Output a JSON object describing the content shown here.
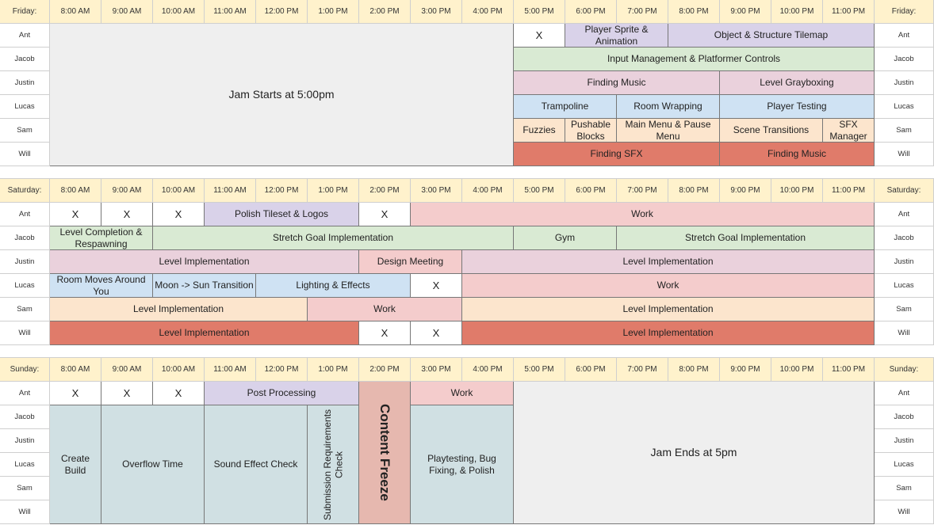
{
  "colors": {
    "header": "#fff2cc",
    "grey": "#efefef",
    "purple": "#d9d2e9",
    "green": "#d9ead3",
    "pink": "#ead1dc",
    "blue": "#cfe2f3",
    "peach": "#fce5cd",
    "red": "#e07b6a",
    "salmon": "#f4cccc",
    "teal": "#d0e0e3",
    "freeze": "#e6b8af",
    "white": "#ffffff"
  },
  "hours": [
    "8:00 AM",
    "9:00 AM",
    "10:00 AM",
    "11:00 AM",
    "12:00 PM",
    "1:00 PM",
    "2:00 PM",
    "3:00 PM",
    "4:00 PM",
    "5:00 PM",
    "6:00 PM",
    "7:00 PM",
    "8:00 PM",
    "9:00 PM",
    "10:00 PM",
    "11:00 PM"
  ],
  "people": [
    "Ant",
    "Jacob",
    "Justin",
    "Lucas",
    "Sam",
    "Will"
  ],
  "days": [
    {
      "label": "Friday:",
      "blocks": [
        {
          "r": 0,
          "c": 0,
          "rs": 6,
          "cs": 9,
          "t": "Jam Starts at 5:00pm",
          "k": "grey",
          "big": true
        },
        {
          "r": 0,
          "c": 9,
          "cs": 1,
          "t": "X",
          "k": "white"
        },
        {
          "r": 0,
          "c": 10,
          "cs": 2,
          "t": "Player Sprite & Animation",
          "k": "purple"
        },
        {
          "r": 0,
          "c": 12,
          "cs": 4,
          "t": "Object & Structure Tilemap",
          "k": "purple"
        },
        {
          "r": 1,
          "c": 9,
          "cs": 7,
          "t": "Input Management & Platformer Controls",
          "k": "green"
        },
        {
          "r": 2,
          "c": 9,
          "cs": 4,
          "t": "Finding Music",
          "k": "pink"
        },
        {
          "r": 2,
          "c": 13,
          "cs": 3,
          "t": "Level Grayboxing",
          "k": "pink"
        },
        {
          "r": 3,
          "c": 9,
          "cs": 2,
          "t": "Trampoline",
          "k": "blue"
        },
        {
          "r": 3,
          "c": 11,
          "cs": 2,
          "t": "Room Wrapping",
          "k": "blue"
        },
        {
          "r": 3,
          "c": 13,
          "cs": 3,
          "t": "Player Testing",
          "k": "blue"
        },
        {
          "r": 4,
          "c": 9,
          "cs": 1,
          "t": "Fuzzies",
          "k": "peach"
        },
        {
          "r": 4,
          "c": 10,
          "cs": 1,
          "t": "Pushable Blocks",
          "k": "peach"
        },
        {
          "r": 4,
          "c": 11,
          "cs": 2,
          "t": "Main Menu & Pause Menu",
          "k": "peach"
        },
        {
          "r": 4,
          "c": 13,
          "cs": 2,
          "t": "Scene Transitions",
          "k": "peach"
        },
        {
          "r": 4,
          "c": 15,
          "cs": 1,
          "t": "SFX Manager",
          "k": "peach"
        },
        {
          "r": 5,
          "c": 9,
          "cs": 4,
          "t": "Finding SFX",
          "k": "red"
        },
        {
          "r": 5,
          "c": 13,
          "cs": 3,
          "t": "Finding Music",
          "k": "red"
        }
      ]
    },
    {
      "label": "Saturday:",
      "blocks": [
        {
          "r": 0,
          "c": 0,
          "cs": 1,
          "t": "X",
          "k": "white"
        },
        {
          "r": 0,
          "c": 1,
          "cs": 1,
          "t": "X",
          "k": "white"
        },
        {
          "r": 0,
          "c": 2,
          "cs": 1,
          "t": "X",
          "k": "white"
        },
        {
          "r": 0,
          "c": 3,
          "cs": 3,
          "t": "Polish Tileset & Logos",
          "k": "purple"
        },
        {
          "r": 0,
          "c": 6,
          "cs": 1,
          "t": "X",
          "k": "white"
        },
        {
          "r": 0,
          "c": 7,
          "cs": 9,
          "t": "Work",
          "k": "salmon"
        },
        {
          "r": 1,
          "c": 0,
          "cs": 2,
          "t": "Level Completion & Respawning",
          "k": "green"
        },
        {
          "r": 1,
          "c": 2,
          "cs": 7,
          "t": "Stretch Goal Implementation",
          "k": "green"
        },
        {
          "r": 1,
          "c": 9,
          "cs": 2,
          "t": "Gym",
          "k": "green"
        },
        {
          "r": 1,
          "c": 11,
          "cs": 5,
          "t": "Stretch Goal Implementation",
          "k": "green"
        },
        {
          "r": 2,
          "c": 0,
          "cs": 6,
          "t": "Level Implementation",
          "k": "pink"
        },
        {
          "r": 2,
          "c": 6,
          "cs": 2,
          "t": "Design Meeting",
          "k": "salmon"
        },
        {
          "r": 2,
          "c": 8,
          "cs": 8,
          "t": "Level Implementation",
          "k": "pink"
        },
        {
          "r": 3,
          "c": 0,
          "cs": 2,
          "t": "Room Moves Around You",
          "k": "blue"
        },
        {
          "r": 3,
          "c": 2,
          "cs": 2,
          "t": "Moon -> Sun Transition",
          "k": "blue"
        },
        {
          "r": 3,
          "c": 4,
          "cs": 3,
          "t": "Lighting & Effects",
          "k": "blue"
        },
        {
          "r": 3,
          "c": 7,
          "cs": 1,
          "t": "X",
          "k": "white"
        },
        {
          "r": 3,
          "c": 8,
          "cs": 8,
          "t": "Work",
          "k": "salmon"
        },
        {
          "r": 4,
          "c": 0,
          "cs": 5,
          "t": "Level Implementation",
          "k": "peach"
        },
        {
          "r": 4,
          "c": 5,
          "cs": 3,
          "t": "Work",
          "k": "salmon"
        },
        {
          "r": 4,
          "c": 8,
          "cs": 8,
          "t": "Level Implementation",
          "k": "peach"
        },
        {
          "r": 5,
          "c": 0,
          "cs": 6,
          "t": "Level Implementation",
          "k": "red"
        },
        {
          "r": 5,
          "c": 6,
          "cs": 1,
          "t": "X",
          "k": "white"
        },
        {
          "r": 5,
          "c": 7,
          "cs": 1,
          "t": "X",
          "k": "white"
        },
        {
          "r": 5,
          "c": 8,
          "cs": 8,
          "t": "Level Implementation",
          "k": "red"
        }
      ]
    },
    {
      "label": "Sunday:",
      "blocks": [
        {
          "r": 0,
          "c": 0,
          "cs": 1,
          "t": "X",
          "k": "white"
        },
        {
          "r": 0,
          "c": 1,
          "cs": 1,
          "t": "X",
          "k": "white"
        },
        {
          "r": 0,
          "c": 2,
          "cs": 1,
          "t": "X",
          "k": "white"
        },
        {
          "r": 0,
          "c": 3,
          "cs": 3,
          "t": "Post Processing",
          "k": "purple"
        },
        {
          "r": 0,
          "c": 6,
          "rs": 6,
          "cs": 1,
          "t": "Content Freeze",
          "k": "freeze",
          "cf": true
        },
        {
          "r": 0,
          "c": 7,
          "cs": 2,
          "t": "Work",
          "k": "salmon"
        },
        {
          "r": 0,
          "c": 9,
          "rs": 6,
          "cs": 7,
          "t": "Jam Ends at 5pm",
          "k": "grey",
          "big": true
        },
        {
          "r": 1,
          "c": 0,
          "rs": 5,
          "cs": 1,
          "t": "Create Build",
          "k": "teal"
        },
        {
          "r": 1,
          "c": 1,
          "rs": 5,
          "cs": 2,
          "t": "Overflow Time",
          "k": "teal"
        },
        {
          "r": 1,
          "c": 3,
          "rs": 5,
          "cs": 2,
          "t": "Sound Effect Check",
          "k": "teal"
        },
        {
          "r": 1,
          "c": 5,
          "rs": 5,
          "cs": 1,
          "t": "Submission Requirements Check",
          "k": "teal",
          "vt": true
        },
        {
          "r": 1,
          "c": 7,
          "rs": 5,
          "cs": 2,
          "t": "Playtesting, Bug Fixing, & Polish",
          "k": "teal"
        }
      ]
    }
  ]
}
